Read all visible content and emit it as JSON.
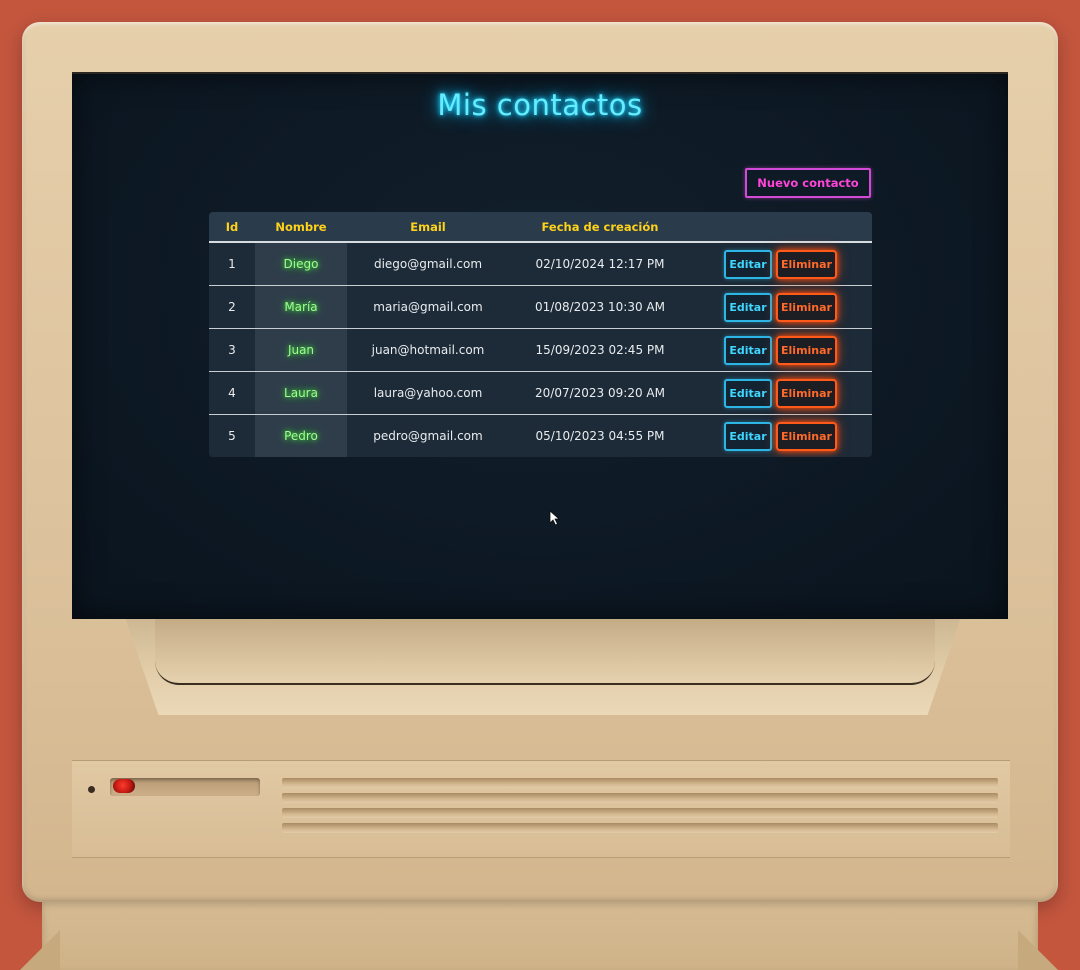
{
  "page": {
    "title": "Mis contactos",
    "new_contact_label": "Nuevo contacto"
  },
  "table": {
    "headers": {
      "id": "Id",
      "name": "Nombre",
      "email": "Email",
      "created": "Fecha de creación"
    },
    "rows": [
      {
        "id": "1",
        "name": "Diego",
        "email": "diego@gmail.com",
        "created": "02/10/2024 12:17 PM"
      },
      {
        "id": "2",
        "name": "María",
        "email": "maria@gmail.com",
        "created": "01/08/2023 10:30 AM"
      },
      {
        "id": "3",
        "name": "Juan",
        "email": "juan@hotmail.com",
        "created": "15/09/2023 02:45 PM"
      },
      {
        "id": "4",
        "name": "Laura",
        "email": "laura@yahoo.com",
        "created": "20/07/2023 09:20 AM"
      },
      {
        "id": "5",
        "name": "Pedro",
        "email": "pedro@gmail.com",
        "created": "05/10/2023 04:55 PM"
      }
    ],
    "edit_label": "Editar",
    "delete_label": "Eliminar"
  },
  "colors": {
    "title_neon": "#64ecff",
    "name_neon": "#9dff8c",
    "header_text": "#ffd21a",
    "new_button": "#ff44d8",
    "edit_button": "#3fd6ff",
    "delete_button": "#ff6a2a",
    "screen_bg": "#0c1722"
  },
  "icons": {
    "pointer": "mouse-pointer-icon",
    "power_led": "power-led-icon"
  }
}
